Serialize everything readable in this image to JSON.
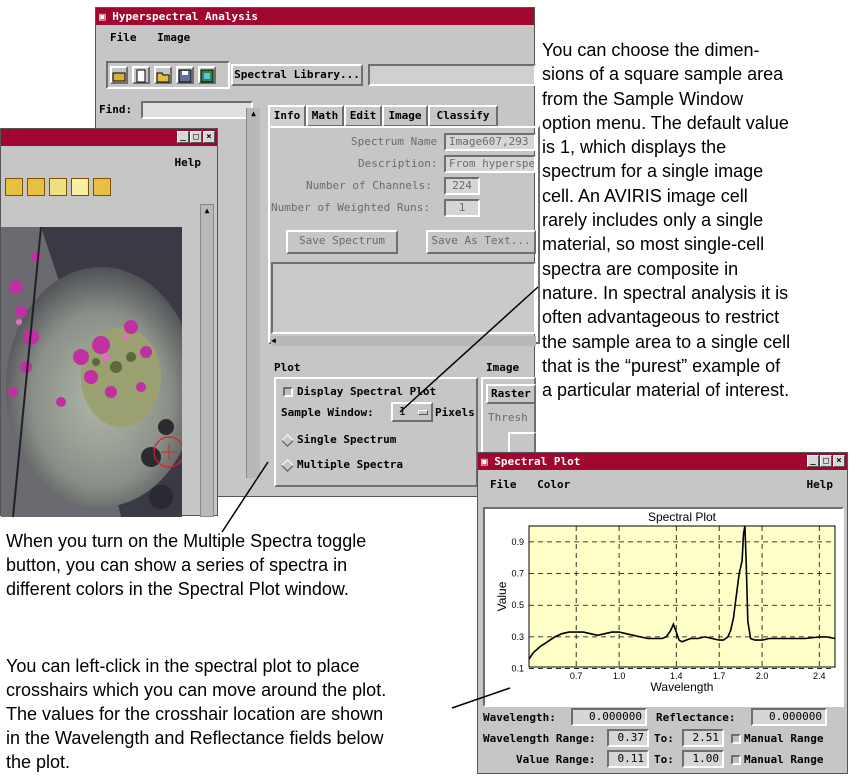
{
  "main_window": {
    "title": "Hyperspectral Analysis",
    "menu": [
      "File",
      "Image"
    ],
    "spectral_library_button": "Spectral Library...",
    "find_label": "Find:",
    "tabs": [
      "Info",
      "Math",
      "Edit",
      "Image",
      "Classify"
    ],
    "info": {
      "spectrum_name_label": "Spectrum Name",
      "spectrum_name_value": "Image607,293",
      "description_label": "Description:",
      "description_value": "From hyperspectral",
      "channels_label": "Number of Channels:",
      "channels_value": "224",
      "weighted_runs_label": "Number of Weighted Runs:",
      "weighted_runs_value": "1",
      "save_spectrum": "Save Spectrum",
      "save_as_text": "Save As Text..."
    },
    "plot_section": {
      "header": "Plot",
      "display_spectral_plot": "Display Spectral Plot",
      "sample_window_label": "Sample Window:",
      "sample_window_value": "1",
      "pixels_label": "Pixels",
      "single_spectrum": "Single Spectrum",
      "multiple_spectra": "Multiple Spectra"
    },
    "image_section": {
      "header": "Image",
      "raster_button": "Raster",
      "threshold_label": "Thresh"
    }
  },
  "image_window": {
    "menu_help": "Help"
  },
  "spectral_plot_window": {
    "title": "Spectral Plot",
    "menu": [
      "File",
      "Color"
    ],
    "help": "Help",
    "wavelength_label": "Wavelength:",
    "wavelength_value": "0.000000",
    "reflectance_label": "Reflectance:",
    "reflectance_value": "0.000000",
    "wavelength_range_label": "Wavelength Range:",
    "wavelength_range_from": "0.37",
    "to_label": "To:",
    "wavelength_range_to": "2.51",
    "manual_range": "Manual Range",
    "value_range_label": "Value Range:",
    "value_range_from": "0.11",
    "value_range_to": "1.00"
  },
  "chart_data": {
    "type": "line",
    "title": "Spectral Plot",
    "xlabel": "Wavelength",
    "ylabel": "Value",
    "xlim": [
      0.37,
      2.51
    ],
    "ylim": [
      0.11,
      1.0
    ],
    "xticks": [
      "0.7",
      "1.0",
      "1.4",
      "1.7",
      "2.0",
      "2.4"
    ],
    "yticks": [
      "0.1",
      "0.3",
      "0.5",
      "0.7",
      "0.9"
    ],
    "grid": true,
    "background": "#ffffc8",
    "series": [
      {
        "color": "#000000",
        "x": [
          0.37,
          0.4,
          0.45,
          0.5,
          0.55,
          0.6,
          0.65,
          0.7,
          0.75,
          0.8,
          0.85,
          0.9,
          0.95,
          1.0,
          1.05,
          1.1,
          1.15,
          1.2,
          1.25,
          1.3,
          1.33,
          1.36,
          1.38,
          1.4,
          1.42,
          1.44,
          1.47,
          1.5,
          1.55,
          1.6,
          1.65,
          1.7,
          1.73,
          1.76,
          1.78,
          1.8,
          1.82,
          1.84,
          1.86,
          1.87,
          1.88,
          1.89,
          1.9,
          1.92,
          1.95,
          2.0,
          2.05,
          2.1,
          2.2,
          2.3,
          2.4,
          2.45,
          2.51
        ],
        "values": [
          0.16,
          0.2,
          0.24,
          0.27,
          0.3,
          0.32,
          0.33,
          0.33,
          0.33,
          0.32,
          0.31,
          0.32,
          0.33,
          0.33,
          0.32,
          0.31,
          0.3,
          0.29,
          0.29,
          0.29,
          0.3,
          0.34,
          0.38,
          0.33,
          0.28,
          0.27,
          0.28,
          0.29,
          0.29,
          0.3,
          0.29,
          0.28,
          0.28,
          0.3,
          0.34,
          0.42,
          0.56,
          0.7,
          0.78,
          0.95,
          1.0,
          0.75,
          0.4,
          0.29,
          0.28,
          0.28,
          0.29,
          0.29,
          0.29,
          0.29,
          0.3,
          0.3,
          0.29
        ]
      }
    ]
  },
  "captions": {
    "right": [
      "You can choose the dimen-",
      "sions of a square sample area",
      "from the Sample Window",
      "option menu. The default value",
      "is 1, which displays the",
      "spectrum for a single image",
      "cell.  An AVIRIS image cell",
      "rarely includes only a single",
      "material, so most single-cell",
      "spectra are composite in",
      "nature.  In spectral analysis it is",
      "often advantageous to restrict",
      "the sample area to a single cell",
      "that is the “purest” example of",
      "a particular material of interest."
    ],
    "left_top": [
      "When you turn on the Multiple Spectra toggle",
      "button, you can show a series of spectra in",
      "different colors in the Spectral Plot window."
    ],
    "left_bottom": [
      "You can left-click in the spectral plot to place",
      "crosshairs which you can move around the plot.",
      "The values for the crosshair location are shown",
      "in the Wavelength and Reflectance fields below",
      "the plot."
    ]
  }
}
